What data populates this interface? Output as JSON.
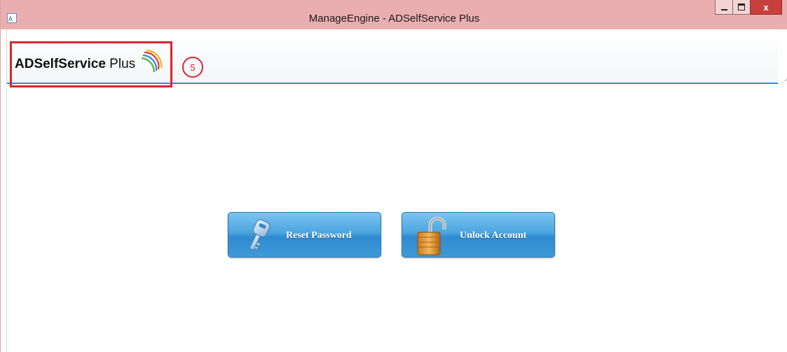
{
  "window": {
    "title": "ManageEngine - ADSelfService Plus",
    "controls": {
      "close_label": "x"
    }
  },
  "header": {
    "logo": {
      "bold_text": "ADSelfService",
      "light_text": " Plus"
    },
    "annotation_badge": "5"
  },
  "actions": {
    "reset_password": {
      "label": "Reset Password",
      "icon": "key-icon"
    },
    "unlock_account": {
      "label": "Unlock Account",
      "icon": "padlock-open-icon"
    }
  },
  "colors": {
    "title_bar": "#eaaeb0",
    "close_button": "#c7403b",
    "annotation": "#d8262e",
    "header_rule": "#2f8fd4",
    "button_blue": "#3f9ad8"
  }
}
